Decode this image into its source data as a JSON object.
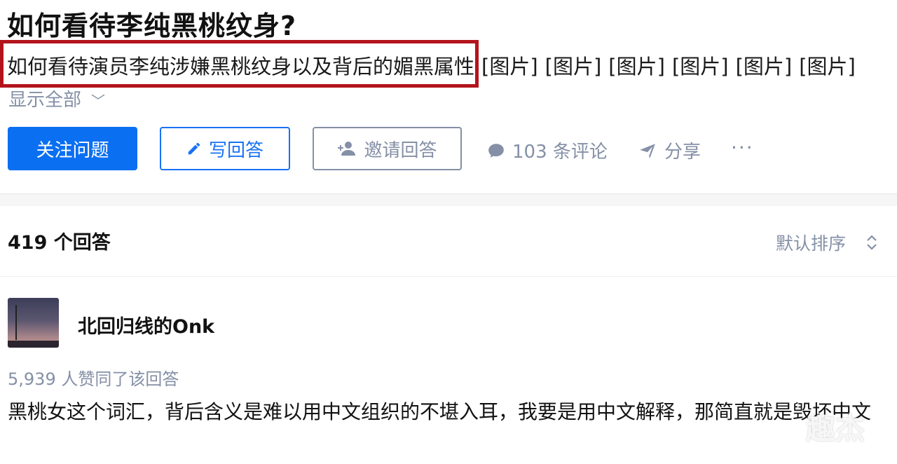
{
  "question": {
    "title": "如何看待李纯黑桃纹身?",
    "detail": "如何看待演员李纯涉嫌黑桃纹身以及背后的媚黑属性",
    "image_tags": [
      "[图片]",
      "[图片]",
      "[图片]",
      "[图片]",
      "[图片]",
      "[图片]"
    ],
    "show_all": "显示全部",
    "follow_label": "关注问题",
    "write_label": "写回答",
    "invite_label": "邀请回答",
    "comments_label": "103 条评论",
    "share_label": "分享",
    "more_label": "···"
  },
  "answers": {
    "count_label": "419 个回答",
    "sort_label": "默认排序",
    "first": {
      "author": "北回归线的Onk",
      "votes": "5,939 人赞同了该回答",
      "content": "黑桃女这个词汇，背后含义是难以用中文组织的不堪入耳，我要是用中文解释，那简直就是毁坏中文"
    }
  },
  "watermark": "趣杰",
  "colors": {
    "primary": "#0b6ff2",
    "muted": "#8590a6",
    "highlight_border": "#b3141c"
  }
}
